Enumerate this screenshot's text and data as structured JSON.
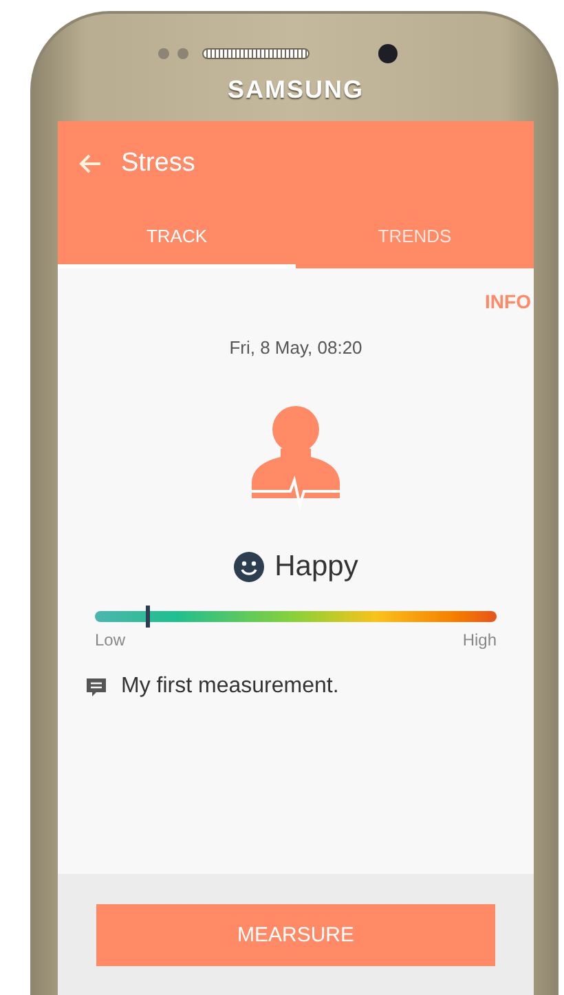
{
  "device": {
    "brand": "SAMSUNG"
  },
  "app_bar": {
    "title": "Stress"
  },
  "tabs": [
    {
      "label": "TRACK",
      "selected": true
    },
    {
      "label": "TRENDS",
      "selected": false
    }
  ],
  "info_link": "INFO",
  "timestamp": "Fri, 8 May, 08:20",
  "mood": {
    "label": "Happy"
  },
  "stress_meter": {
    "level": 0.13,
    "low_label": "Low",
    "high_label": "High"
  },
  "note": "My first measurement.",
  "buttons": [
    {
      "label": "MEARSURE"
    }
  ]
}
